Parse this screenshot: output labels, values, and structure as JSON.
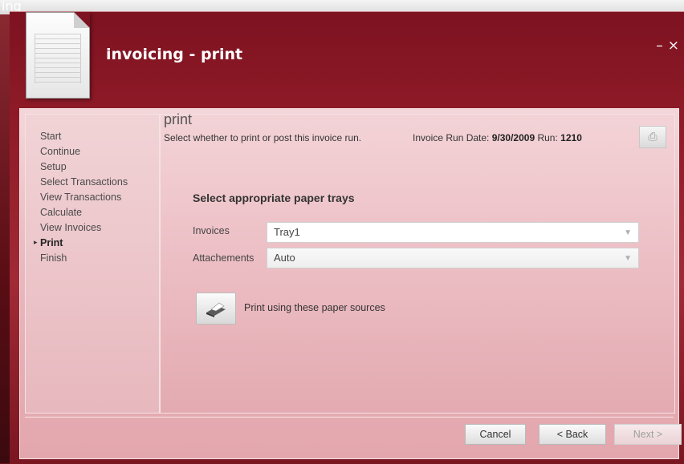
{
  "background": {
    "fragment_text": "ing"
  },
  "window": {
    "title": "invoicing - print",
    "minimize": "–",
    "close": "×",
    "icon": "document-icon"
  },
  "nav": {
    "items": [
      {
        "label": "Start",
        "active": false
      },
      {
        "label": "Continue",
        "active": false
      },
      {
        "label": "Setup",
        "active": false
      },
      {
        "label": "Select Transactions",
        "active": false
      },
      {
        "label": "View Transactions",
        "active": false
      },
      {
        "label": "Calculate",
        "active": false
      },
      {
        "label": "View Invoices",
        "active": false
      },
      {
        "label": "Print",
        "active": true
      },
      {
        "label": "Finish",
        "active": false
      }
    ],
    "active_marker": "▸"
  },
  "main": {
    "title": "print",
    "subtitle": "Select whether to print or post this invoice run.",
    "run_date_label": "Invoice Run Date:",
    "run_date": "9/30/2009",
    "run_label": "Run:",
    "run_number": "1210",
    "run_button_icon": "document-search-icon",
    "section_title": "Select appropriate paper trays",
    "fields": {
      "invoices": {
        "label": "Invoices",
        "value": "Tray1"
      },
      "attachments": {
        "label": "Attachements",
        "value": "Auto"
      }
    },
    "print_label": "Print using these paper sources",
    "print_icon": "printer-icon"
  },
  "footer": {
    "cancel": "Cancel",
    "back": "< Back",
    "next": "Next >"
  },
  "colors": {
    "window_bg": "#8e1a27",
    "panel_bg": "#e9b8bd"
  }
}
